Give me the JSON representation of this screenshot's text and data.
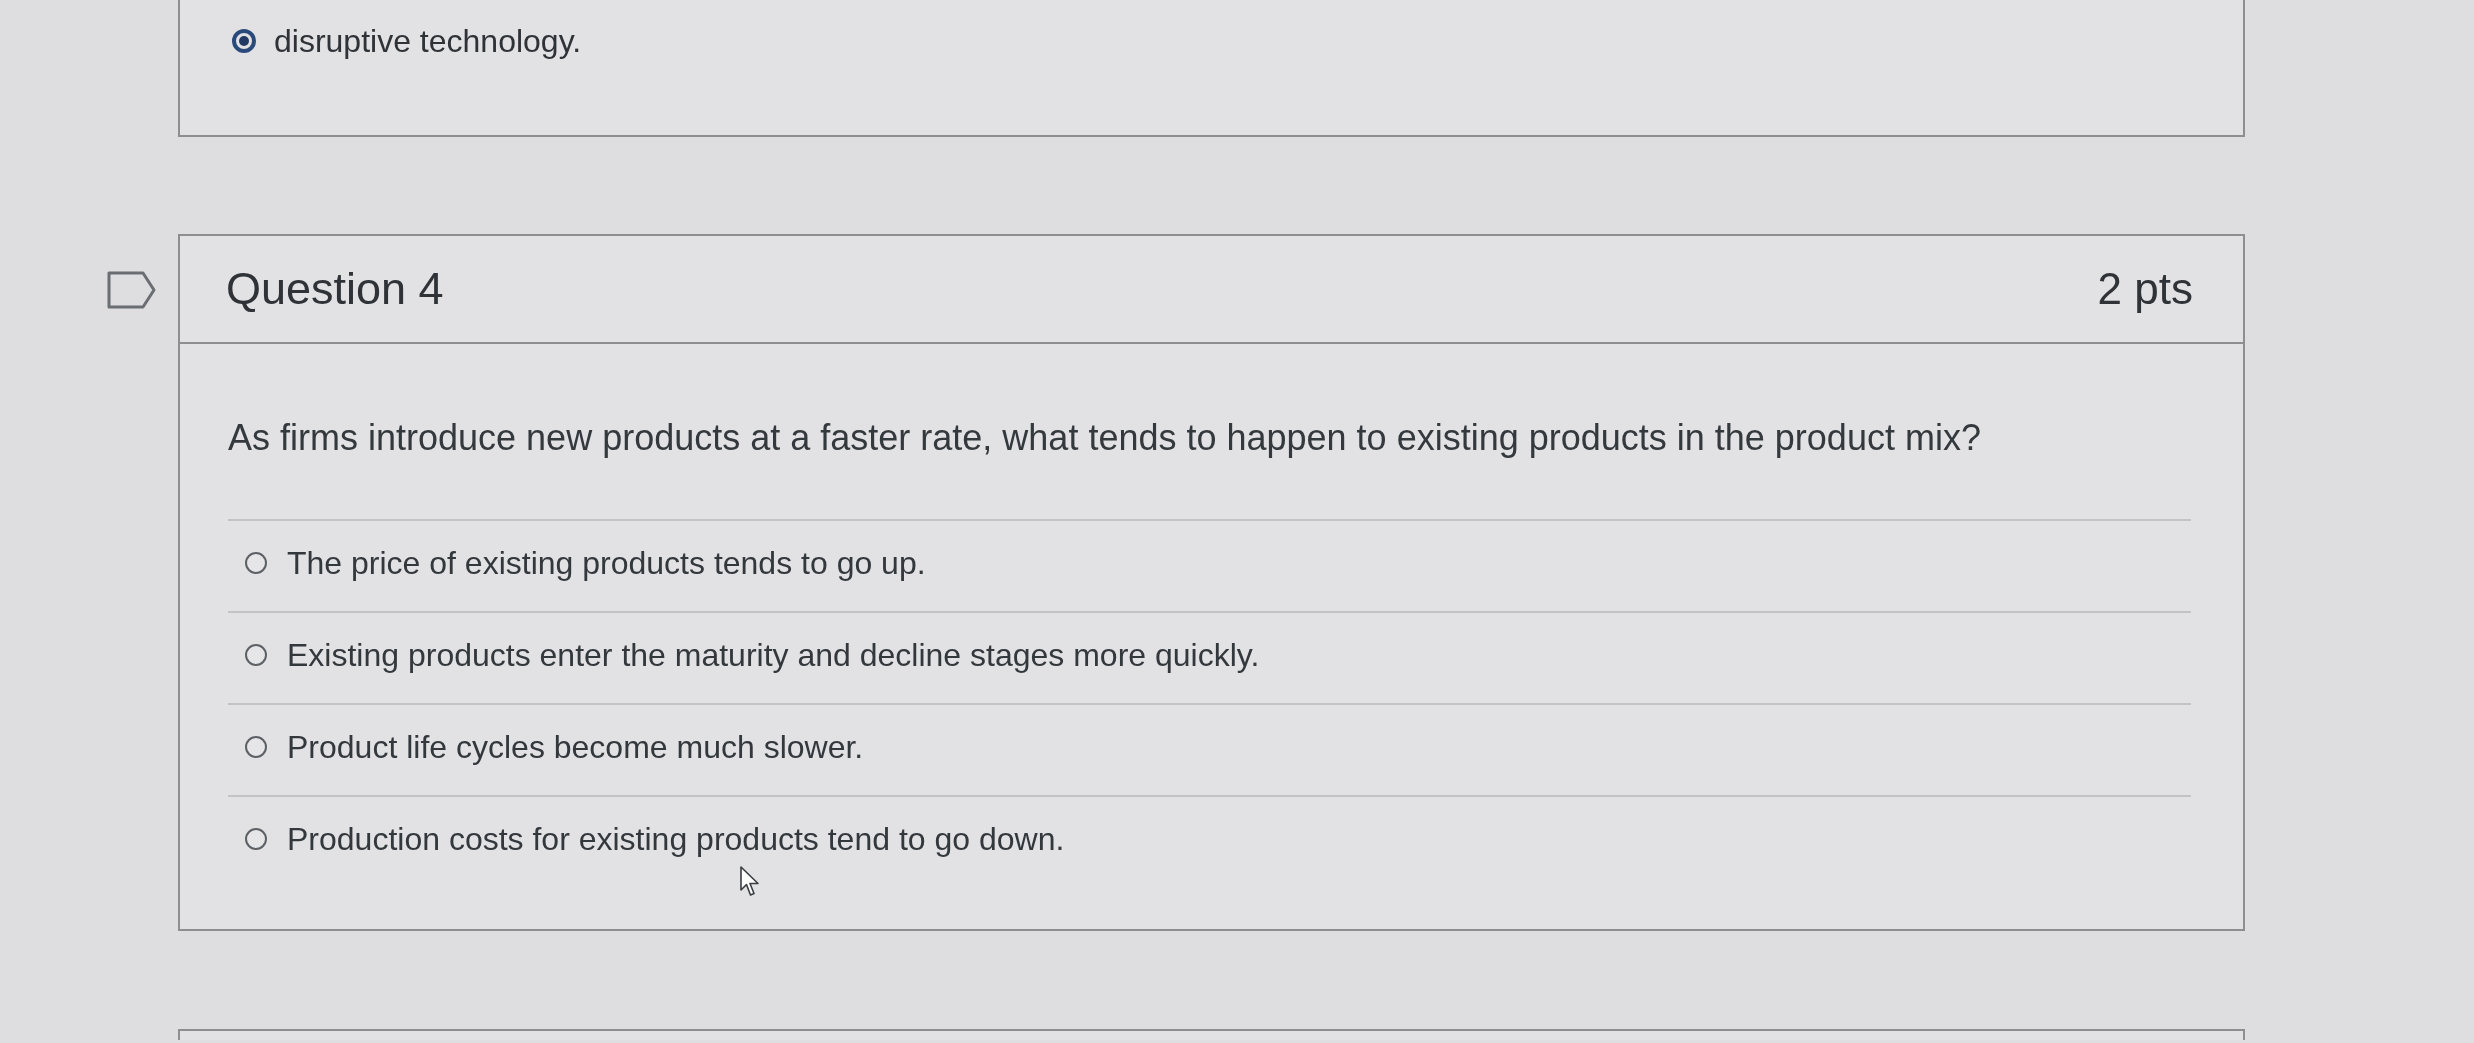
{
  "previous_question": {
    "answers": [
      {
        "text": "disruptive technology.",
        "selected": true
      }
    ]
  },
  "question": {
    "flagged": false,
    "title": "Question 4",
    "points": "2 pts",
    "prompt": "As firms introduce new products at a faster rate, what tends to happen to existing products in the product mix?",
    "answers": [
      {
        "text": "The price of existing products tends to go up.",
        "selected": false
      },
      {
        "text": "Existing products enter the maturity and decline stages more quickly.",
        "selected": false
      },
      {
        "text": "Product life cycles become much slower.",
        "selected": false
      },
      {
        "text": "Production costs for existing products tend to go down.",
        "selected": false
      }
    ]
  }
}
